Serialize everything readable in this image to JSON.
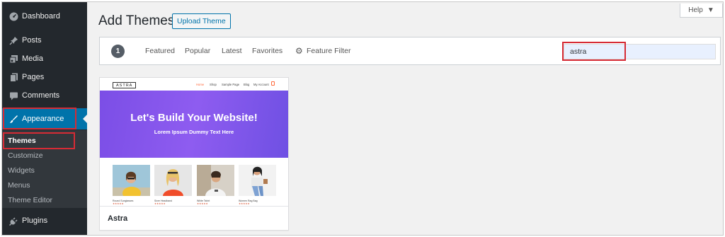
{
  "sidebar": {
    "items": [
      {
        "label": "Dashboard",
        "icon": "dashboard-icon"
      },
      {
        "label": "Posts",
        "icon": "pin-icon"
      },
      {
        "label": "Media",
        "icon": "media-icon"
      },
      {
        "label": "Pages",
        "icon": "pages-icon"
      },
      {
        "label": "Comments",
        "icon": "comment-icon"
      },
      {
        "label": "Appearance",
        "icon": "paintbrush-icon"
      },
      {
        "label": "Plugins",
        "icon": "plug-icon"
      }
    ],
    "submenu": [
      "Themes",
      "Customize",
      "Widgets",
      "Menus",
      "Theme Editor"
    ]
  },
  "header": {
    "title": "Add Themes",
    "upload_label": "Upload Theme",
    "help_label": "Help"
  },
  "filter": {
    "count": "1",
    "tabs": [
      "Featured",
      "Popular",
      "Latest",
      "Favorites"
    ],
    "feature_filter": "Feature Filter",
    "search_value": "astra"
  },
  "theme": {
    "name": "Astra",
    "preview": {
      "logo": "ASTRA",
      "nav": [
        "Home",
        "Shop",
        "Sample Page",
        "Blog",
        "My Account"
      ],
      "hero_title": "Let's Build Your Website!",
      "hero_subtitle": "Lorem Ipsum Dummy Text Here",
      "products": [
        "Round Sunglasses",
        "Siver Headband",
        "White Tshirt",
        "Women Rag Bag"
      ],
      "stars": "★★★★★"
    }
  },
  "colors": {
    "sidebar_bg": "#23282d",
    "accent": "#0073aa",
    "highlight_border": "#d62b35",
    "hero": "#8e5cf0"
  }
}
